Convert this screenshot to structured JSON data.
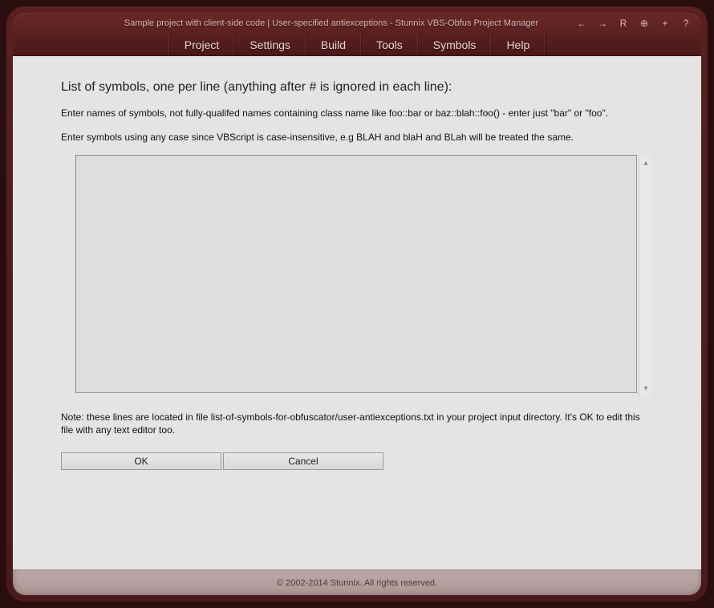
{
  "titlebar": {
    "title": "Sample project with client-side code | User-specified antiexceptions - Stunnix VBS-Obfus Project Manager"
  },
  "menu": {
    "items": [
      "Project",
      "Settings",
      "Build",
      "Tools",
      "Symbols",
      "Help"
    ]
  },
  "content": {
    "heading": "List of symbols, one per line (anything after # is ignored in each line):",
    "desc1": "Enter names of symbols, not fully-qualifed names containing class name like foo::bar or baz::blah::foo() - enter just \"bar\" or \"foo\".",
    "desc2": "Enter symbols using any case since VBScript is case-insensitive, e.g BLAH and blaH and BLah will be treated the same.",
    "textarea_value": "",
    "note": "Note: these lines are located in file list-of-symbols-for-obfuscator/user-antiexceptions.txt in your project input directory. It's OK to edit this file with any text editor too.",
    "ok_label": "OK",
    "cancel_label": "Cancel"
  },
  "footer": {
    "text": "© 2002-2014 Stunnix. All rights reserved."
  },
  "icons": {
    "back": "←",
    "forward": "→",
    "reload": "R",
    "zoom": "⊕",
    "plus": "+",
    "help": "?"
  }
}
